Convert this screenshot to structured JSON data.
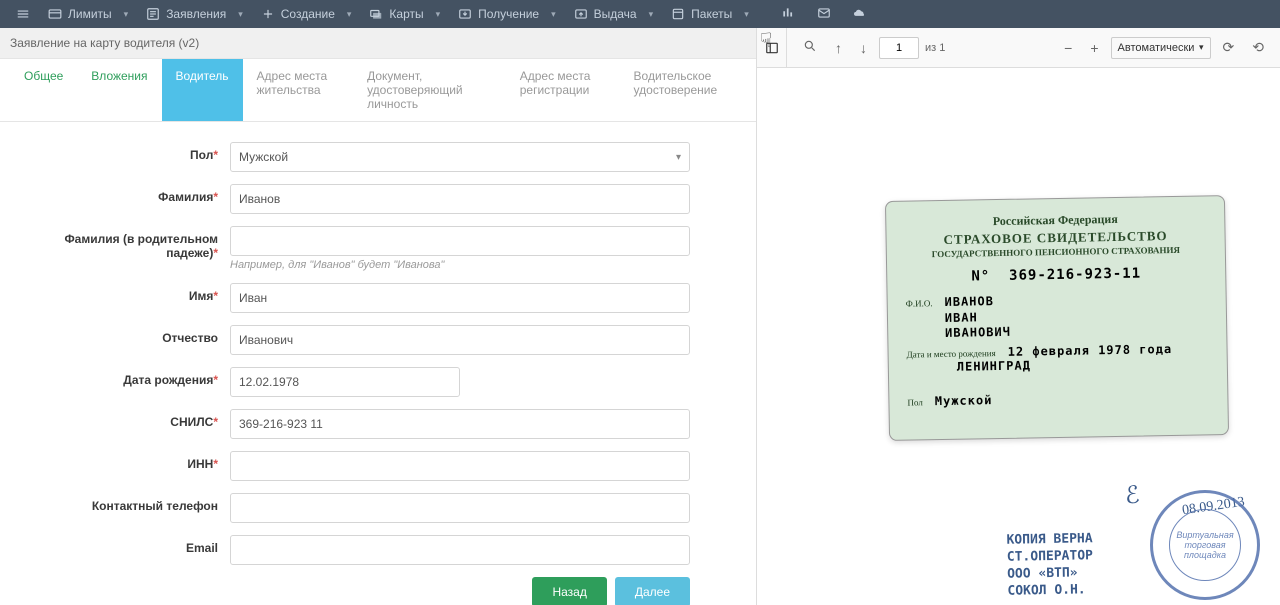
{
  "nav": {
    "items": [
      {
        "label": "Лимиты"
      },
      {
        "label": "Заявления"
      },
      {
        "label": "Создание"
      },
      {
        "label": "Карты"
      },
      {
        "label": "Получение"
      },
      {
        "label": "Выдача"
      },
      {
        "label": "Пакеты"
      }
    ]
  },
  "breadcrumb": "Заявление на карту водителя (v2)",
  "tabs": [
    {
      "label": "Общее"
    },
    {
      "label": "Вложения"
    },
    {
      "label": "Водитель"
    },
    {
      "label": "Адрес места жительства"
    },
    {
      "label": "Документ, удостоверяющий личность"
    },
    {
      "label": "Адрес места регистрации"
    },
    {
      "label": "Водительское удостоверение"
    }
  ],
  "form": {
    "gender_label": "Пол",
    "gender_value": "Мужской",
    "lastname_label": "Фамилия",
    "lastname_value": "Иванов",
    "lastname_gen_label": "Фамилия (в родительном падеже)",
    "lastname_gen_value": "",
    "lastname_gen_hint": "Например, для \"Иванов\" будет \"Иванова\"",
    "firstname_label": "Имя",
    "firstname_value": "Иван",
    "middlename_label": "Отчество",
    "middlename_value": "Иванович",
    "dob_label": "Дата рождения",
    "dob_value": "12.02.1978",
    "snils_label": "СНИЛС",
    "snils_value": "369-216-923 11",
    "inn_label": "ИНН",
    "inn_value": "",
    "phone_label": "Контактный телефон",
    "phone_value": "",
    "email_label": "Email",
    "email_value": "",
    "back_btn": "Назад",
    "next_btn": "Далее"
  },
  "pdf": {
    "page_current": "1",
    "page_total": "из 1",
    "zoom_mode": "Автоматически"
  },
  "snils_card": {
    "country": "Российская Федерация",
    "title": "СТРАХОВОЕ СВИДЕТЕЛЬСТВО",
    "subtitle": "ГОСУДАРСТВЕННОГО ПЕНСИОННОГО СТРАХОВАНИЯ",
    "number_label": "N°",
    "number": "369-216-923-11",
    "fio_label": "Ф.И.О.",
    "lastname": "ИВАНОВ",
    "firstname": "ИВАН",
    "middlename": "ИВАНОВИЧ",
    "dob_label": "Дата и место рождения",
    "dob_value": "12 февраля 1978 года",
    "place": "ЛЕНИНГРАД",
    "gender_label": "Пол",
    "gender": "Мужской"
  },
  "stamp": {
    "line1": "КОПИЯ ВЕРНА",
    "line2": "СТ.ОПЕРАТОР",
    "line3": "ООО «ВТП»",
    "line4": "СОКОЛ О.Н.",
    "round1": "Виртуальная",
    "round2": "торговая",
    "round3": "площадка",
    "date": "08.09.2013"
  }
}
